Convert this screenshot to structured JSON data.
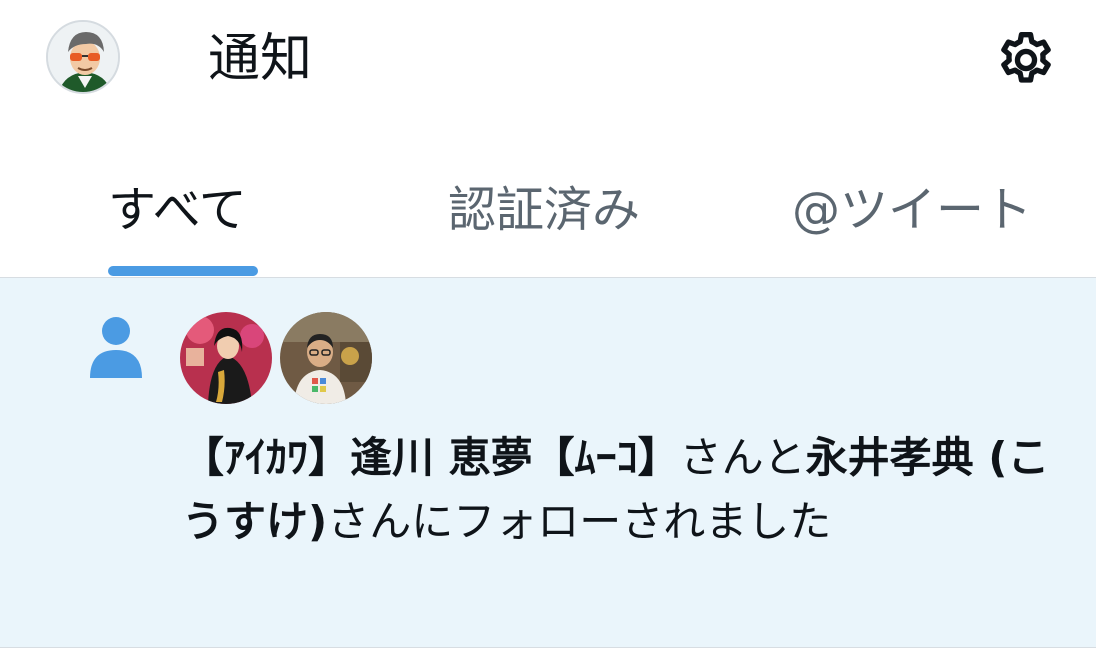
{
  "header": {
    "title": "通知",
    "avatar_icon": "user-avatar",
    "settings_icon": "gear-icon"
  },
  "tabs": [
    {
      "label": "すべて",
      "selected": true
    },
    {
      "label": "認証済み",
      "selected": false
    },
    {
      "label": "@ツイート",
      "selected": false
    }
  ],
  "notification": {
    "type_icon": "person-icon",
    "user1_name": "【ｱｲｶﾜ】逢川 恵夢【ﾑｰｺ】",
    "connector": "さんと",
    "user2_name": "永井孝典 (こうすけ)",
    "suffix": "さんにフォローされました"
  },
  "colors": {
    "accent": "#4b9be3",
    "highlight_bg": "#eaf5fb",
    "text_primary": "#0f1419",
    "text_secondary": "#5b6670"
  }
}
